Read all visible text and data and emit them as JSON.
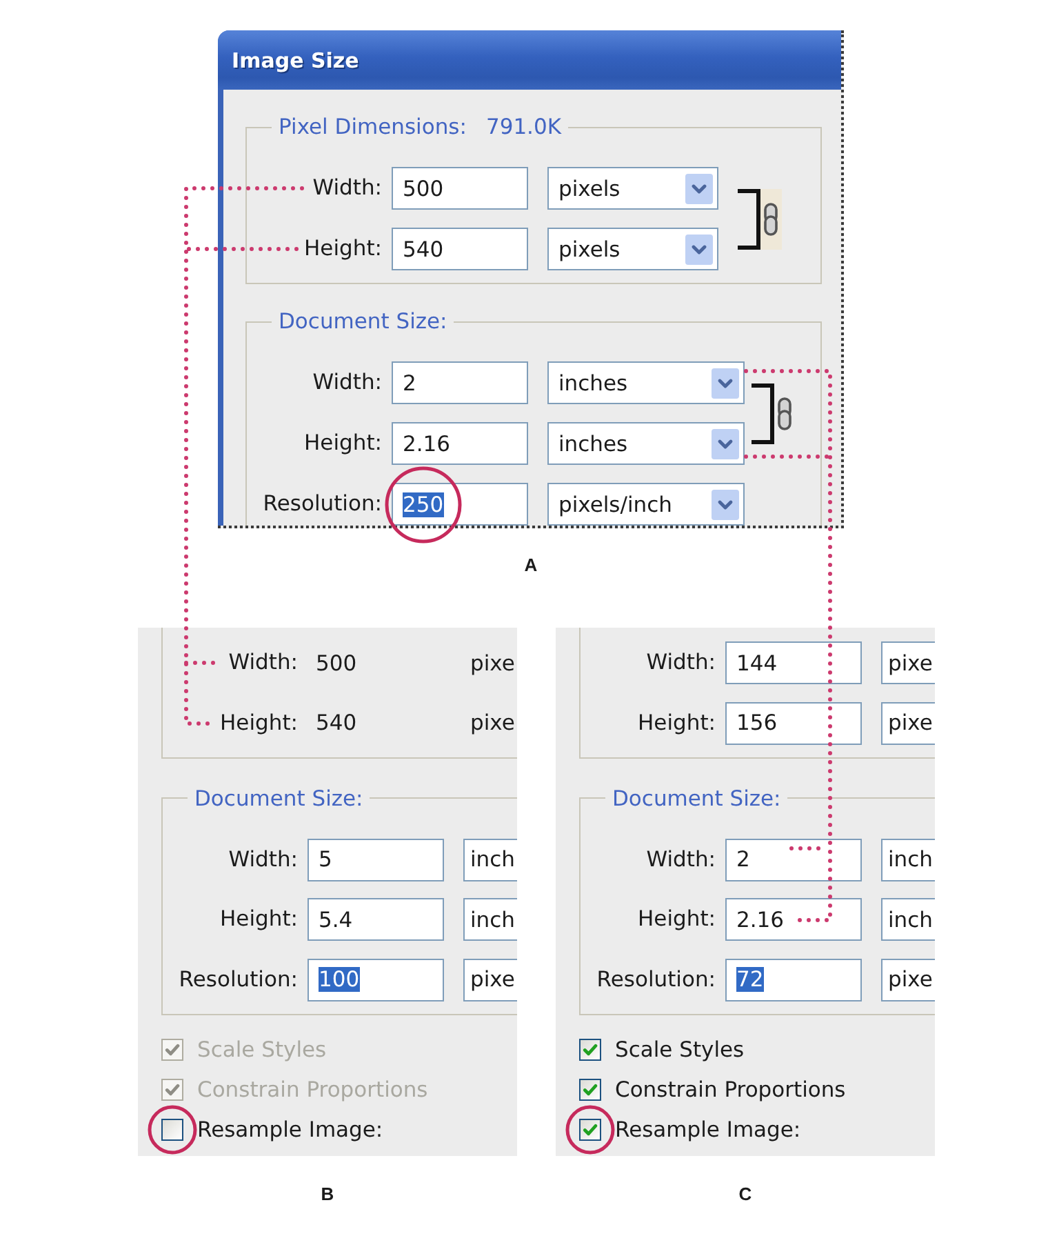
{
  "panels": [
    {
      "kind": "dialog",
      "label": "A",
      "window": {
        "title": "Image Size"
      },
      "pixel_dimensions": {
        "legend": "Pixel Dimensions:",
        "size": "791.0K",
        "editable": true,
        "linked": true,
        "fields": [
          {
            "label": "Width:",
            "value": "500",
            "unit": "pixels",
            "selected": false,
            "circled": false
          },
          {
            "label": "Height:",
            "value": "540",
            "unit": "pixels",
            "selected": false,
            "circled": false
          }
        ]
      },
      "document_size": {
        "legend": "Document Size:",
        "editable": true,
        "linked": true,
        "fields": [
          {
            "label": "Width:",
            "value": "2",
            "unit": "inches",
            "selected": false,
            "circled": false
          },
          {
            "label": "Height:",
            "value": "2.16",
            "unit": "inches",
            "selected": false,
            "circled": false
          },
          {
            "label": "Resolution:",
            "value": "250",
            "unit": "pixels/inch",
            "selected": true,
            "circled": true
          }
        ]
      }
    },
    {
      "kind": "excerpt",
      "label": "B",
      "pixel_dimensions": {
        "editable": false,
        "fields": [
          {
            "label": "Width:",
            "value": "500",
            "unit": "pixe",
            "selected": false,
            "circled": false
          },
          {
            "label": "Height:",
            "value": "540",
            "unit": "pixe",
            "selected": false,
            "circled": false
          }
        ]
      },
      "document_size": {
        "legend": "Document Size:",
        "editable": true,
        "fields": [
          {
            "label": "Width:",
            "value": "5",
            "unit": "inch",
            "selected": false,
            "circled": false
          },
          {
            "label": "Height:",
            "value": "5.4",
            "unit": "inch",
            "selected": false,
            "circled": false
          },
          {
            "label": "Resolution:",
            "value": "100",
            "unit": "pixe",
            "selected": true,
            "circled": false
          }
        ]
      },
      "checkboxes": [
        {
          "label": "Scale Styles",
          "checked": true,
          "disabled": true,
          "circled": false
        },
        {
          "label": "Constrain Proportions",
          "checked": true,
          "disabled": true,
          "circled": false
        },
        {
          "label": "Resample Image:",
          "checked": false,
          "disabled": false,
          "circled": true
        }
      ]
    },
    {
      "kind": "excerpt",
      "label": "C",
      "pixel_dimensions": {
        "editable": true,
        "fields": [
          {
            "label": "Width:",
            "value": "144",
            "unit": "pixe",
            "selected": false,
            "circled": false
          },
          {
            "label": "Height:",
            "value": "156",
            "unit": "pixe",
            "selected": false,
            "circled": false
          }
        ]
      },
      "document_size": {
        "legend": "Document Size:",
        "editable": true,
        "fields": [
          {
            "label": "Width:",
            "value": "2",
            "unit": "inch",
            "selected": false,
            "circled": false
          },
          {
            "label": "Height:",
            "value": "2.16",
            "unit": "inch",
            "selected": false,
            "circled": false
          },
          {
            "label": "Resolution:",
            "value": "72",
            "unit": "pixe",
            "selected": true,
            "circled": false
          }
        ]
      },
      "checkboxes": [
        {
          "label": "Scale Styles",
          "checked": true,
          "disabled": false,
          "circled": false
        },
        {
          "label": "Constrain Proportions",
          "checked": true,
          "disabled": false,
          "circled": false
        },
        {
          "label": "Resample Image:",
          "checked": true,
          "disabled": false,
          "circled": true
        }
      ]
    }
  ]
}
